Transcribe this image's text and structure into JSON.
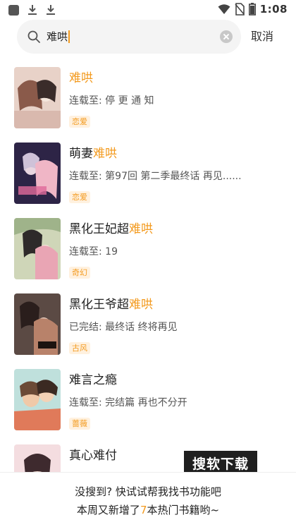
{
  "status_bar": {
    "time": "1:08",
    "icons": [
      "app-square-icon",
      "download-icon",
      "download-icon",
      "wifi-icon",
      "no-sim-icon",
      "battery-icon"
    ]
  },
  "search": {
    "query": "难哄",
    "cancel_label": "取消"
  },
  "highlight_color": "#f39a1e",
  "results": [
    {
      "title_prefix": "",
      "title_highlight": "难哄",
      "title_suffix": "",
      "status": "连载至: 停 更 通 知",
      "tag": "恋爱"
    },
    {
      "title_prefix": "萌妻",
      "title_highlight": "难哄",
      "title_suffix": "",
      "status": "连载至: 第97回 第二季最终话 再见......",
      "tag": "恋爱"
    },
    {
      "title_prefix": "黑化王妃超",
      "title_highlight": "难哄",
      "title_suffix": "",
      "status": "连载至: 19",
      "tag": "奇幻"
    },
    {
      "title_prefix": "黑化王爷超",
      "title_highlight": "难哄",
      "title_suffix": "",
      "status": "已完结: 最终话 终将再见",
      "tag": "古风"
    },
    {
      "title_prefix": "难言之瘾",
      "title_highlight": "",
      "title_suffix": "",
      "status": "连载至: 完结篇 再也不分开",
      "tag": "蔷薇"
    },
    {
      "title_prefix": "真心难付",
      "title_highlight": "",
      "title_suffix": "",
      "status": "",
      "tag": ""
    }
  ],
  "bottom": {
    "line1": "没搜到? 快试试帮我找书功能吧",
    "line2_prefix": "本周又新增了",
    "line2_number": "7",
    "line2_suffix": "本热门书籍哟~"
  },
  "watermark": "搜软下载"
}
